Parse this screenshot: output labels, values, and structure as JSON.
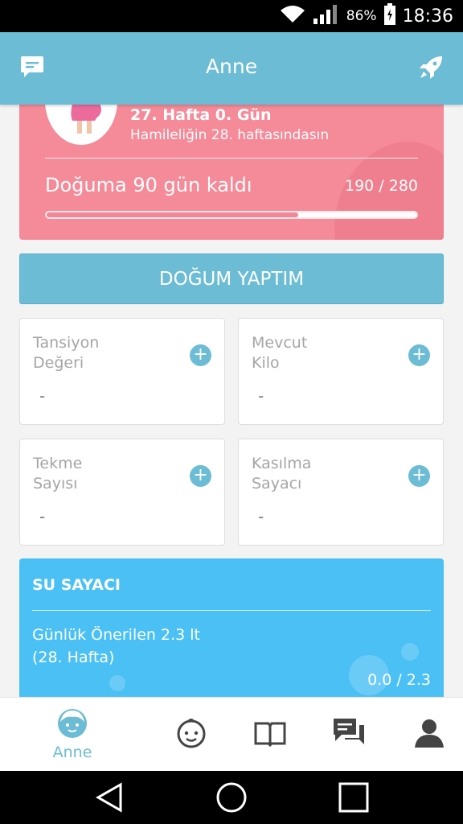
{
  "status_bar": {
    "battery": "86%",
    "time": "18:36"
  },
  "app_bar": {
    "title": "Anne"
  },
  "pregnancy_card": {
    "week_title": "27. Hafta 0. Gün",
    "week_subtitle": "Hamileliğin 28. haftasındasın",
    "due_text": "Doğuma 90 gün kaldı",
    "day_count": "190 / 280",
    "progress_fraction": 0.68
  },
  "birth_button": {
    "label": "DOĞUM YAPTIM"
  },
  "tiles": [
    {
      "label_line1": "Tansiyon",
      "label_line2": "Değeri",
      "value": "-"
    },
    {
      "label_line1": "Mevcut",
      "label_line2": "Kilo",
      "value": "-"
    },
    {
      "label_line1": "Tekme",
      "label_line2": "Sayısı",
      "value": "-"
    },
    {
      "label_line1": "Kasılma",
      "label_line2": "Sayacı",
      "value": "-"
    }
  ],
  "water_card": {
    "title": "SU SAYACI",
    "recommended": "Günlük Önerilen 2.3 lt",
    "week": "(28. Hafta)",
    "count": "0.0 / 2.3"
  },
  "bottom_nav": {
    "active_label": "Anne",
    "items": [
      "mother-icon",
      "baby-icon",
      "book-icon",
      "chat-icon",
      "profile-icon"
    ]
  },
  "colors": {
    "primary": "#6bbcd4",
    "pink": "#f58a98",
    "water": "#4bc0f5"
  }
}
